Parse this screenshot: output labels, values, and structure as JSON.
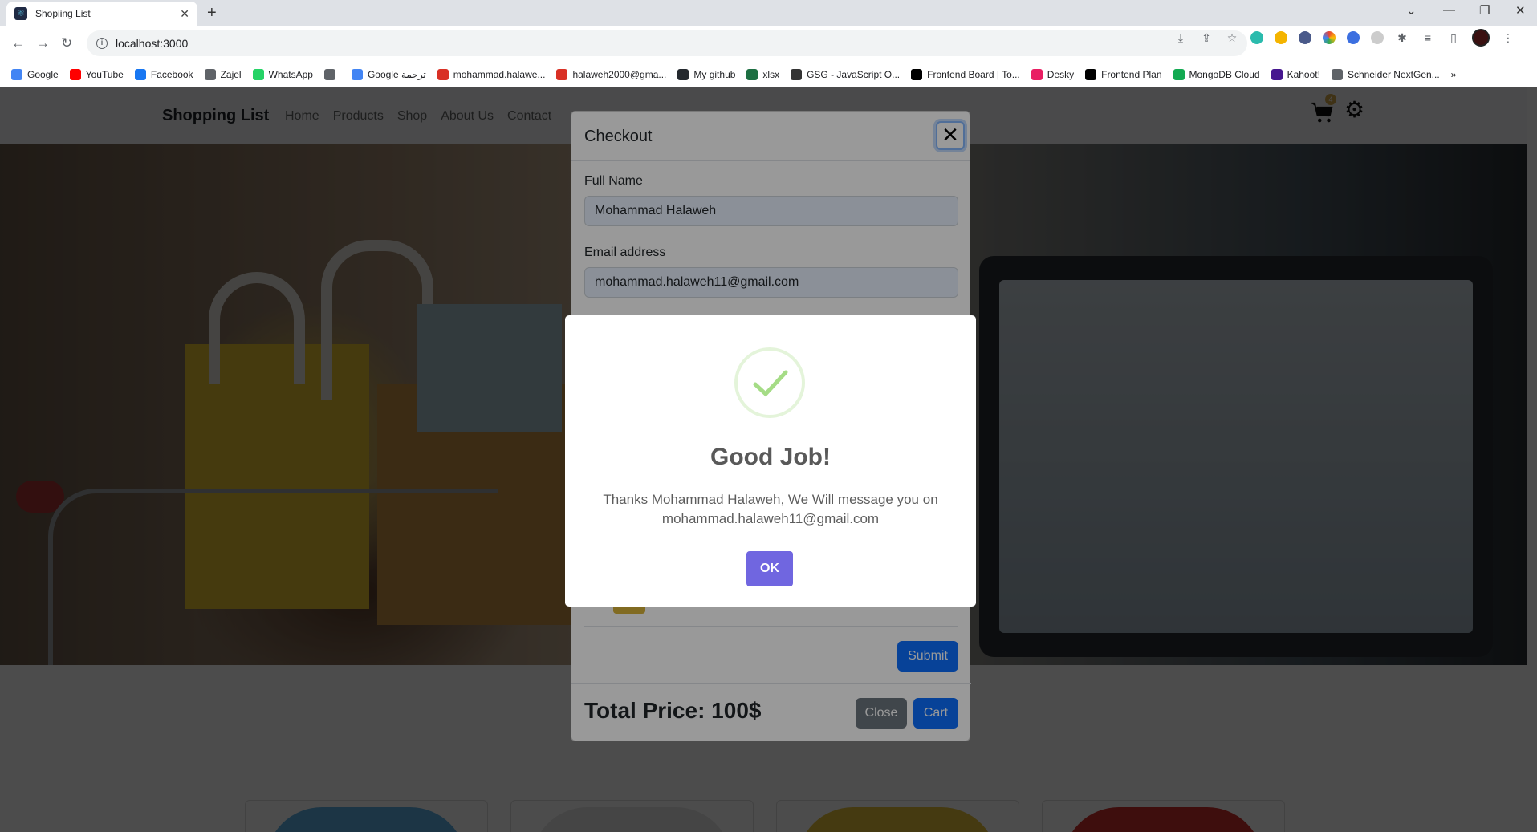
{
  "browser": {
    "tab_title": "Shopiing List",
    "url": "localhost:3000",
    "bookmarks": [
      {
        "label": "Google",
        "color": "#4285f4"
      },
      {
        "label": "YouTube",
        "color": "#ff0000"
      },
      {
        "label": "Facebook",
        "color": "#1877f2"
      },
      {
        "label": "Zajel",
        "color": "#5f6368"
      },
      {
        "label": "WhatsApp",
        "color": "#25d366"
      },
      {
        "label": "",
        "color": "#5f6368"
      },
      {
        "label": "Google ترجمة",
        "color": "#4285f4"
      },
      {
        "label": "mohammad.halawe...",
        "color": "#d93025"
      },
      {
        "label": "halaweh2000@gma...",
        "color": "#d93025"
      },
      {
        "label": "My github",
        "color": "#24292e"
      },
      {
        "label": "xlsx",
        "color": "#1d6f42"
      },
      {
        "label": "GSG - JavaScript O...",
        "color": "#333333"
      },
      {
        "label": "Frontend Board | To...",
        "color": "#000000"
      },
      {
        "label": "Desky",
        "color": "#e91e63"
      },
      {
        "label": "Frontend Plan",
        "color": "#000000"
      },
      {
        "label": "MongoDB Cloud",
        "color": "#13aa52"
      },
      {
        "label": "Kahoot!",
        "color": "#46178f"
      },
      {
        "label": "Schneider NextGen...",
        "color": "#5f6368"
      }
    ]
  },
  "site": {
    "brand": "Shopping List",
    "nav": [
      "Home",
      "Products",
      "Shop",
      "About Us",
      "Contact"
    ],
    "cart_count": "4"
  },
  "checkout": {
    "title": "Checkout",
    "full_name_label": "Full Name",
    "full_name_value": "Mohammad Halaweh",
    "email_label": "Email address",
    "email_value": "mohammad.halaweh11@gmail.com",
    "submit_label": "Submit",
    "total_label": "Total Price: 100$",
    "close_label": "Close",
    "cart_label": "Cart"
  },
  "alert": {
    "title": "Good Job!",
    "text": "Thanks Mohammad Halaweh, We Will message you on mohammad.halaweh11@gmail.com",
    "ok_label": "OK",
    "success_color": "#a5dc86",
    "button_color": "#7066e0"
  },
  "products": [
    {
      "color": "#5fb3e8"
    },
    {
      "color": "#e6e6e6"
    },
    {
      "color": "#e8c43a"
    },
    {
      "color": "#d0302c"
    }
  ]
}
